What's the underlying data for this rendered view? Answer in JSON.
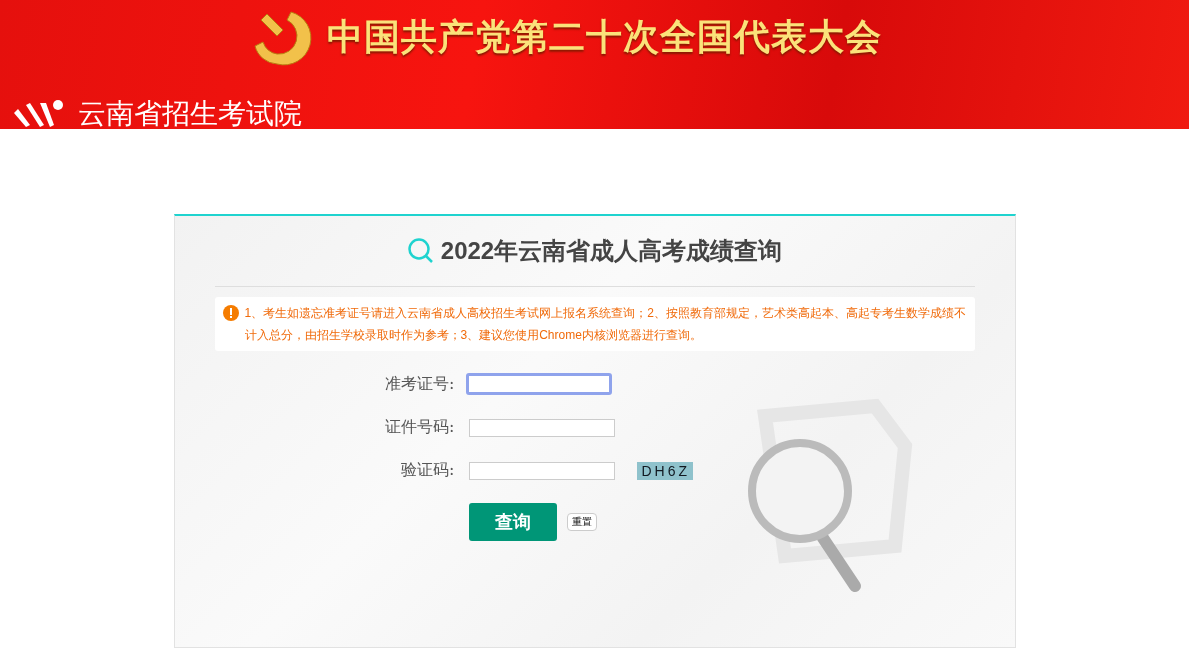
{
  "banner": {
    "headline": "中国共产党第二十次全国代表大会",
    "org_name": "云南省招生考试院"
  },
  "panel": {
    "title": "2022年云南省成人高考成绩查询",
    "notice": "1、考生如遗忘准考证号请进入云南省成人高校招生考试网上报名系统查询；2、按照教育部规定，艺术类高起本、高起专考生数学成绩不计入总分，由招生学校录取时作为参考；3、建议您使用Chrome内核浏览器进行查询。",
    "fields": [
      {
        "label": "准考证号:",
        "focused": true,
        "kind": "text"
      },
      {
        "label": "证件号码:",
        "focused": false,
        "kind": "text"
      },
      {
        "label": "验证码:",
        "focused": false,
        "kind": "captcha"
      }
    ],
    "captcha": "DH6Z",
    "buttons": {
      "submit": "查询",
      "reset": "重置"
    }
  }
}
